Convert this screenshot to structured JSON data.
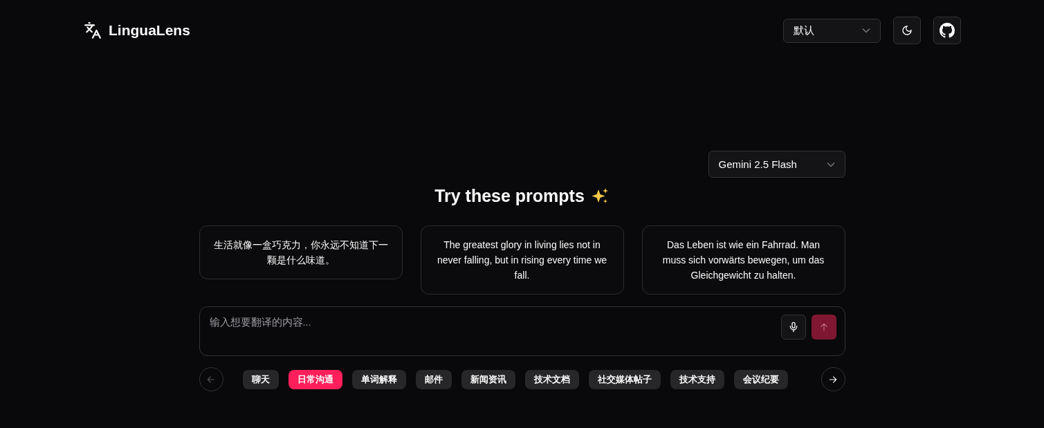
{
  "header": {
    "logo": "LinguaLens",
    "language_select": "默认"
  },
  "model_select": "Gemini 2.5 Flash",
  "title": "Try these prompts",
  "prompts": [
    {
      "text": "生活就像一盒巧克力，你永远不知道下一颗是什么味道。"
    },
    {
      "text": "The greatest glory in living lies not in never falling, but in rising every time we fall."
    },
    {
      "text": "Das Leben ist wie ein Fahrrad. Man muss sich vorwärts bewegen, um das Gleichgewicht zu halten."
    }
  ],
  "input": {
    "placeholder": "输入想要翻译的内容..."
  },
  "send_disabled": true,
  "prev_disabled": true,
  "next_disabled": false,
  "categories": [
    {
      "label": "聊天",
      "selected": false
    },
    {
      "label": "日常沟通",
      "selected": true
    },
    {
      "label": "单词解释",
      "selected": false
    },
    {
      "label": "邮件",
      "selected": false
    },
    {
      "label": "新闻资讯",
      "selected": false
    },
    {
      "label": "技术文档",
      "selected": false
    },
    {
      "label": "社交媒体帖子",
      "selected": false
    },
    {
      "label": "技术支持",
      "selected": false
    },
    {
      "label": "会议纪要",
      "selected": false
    }
  ]
}
